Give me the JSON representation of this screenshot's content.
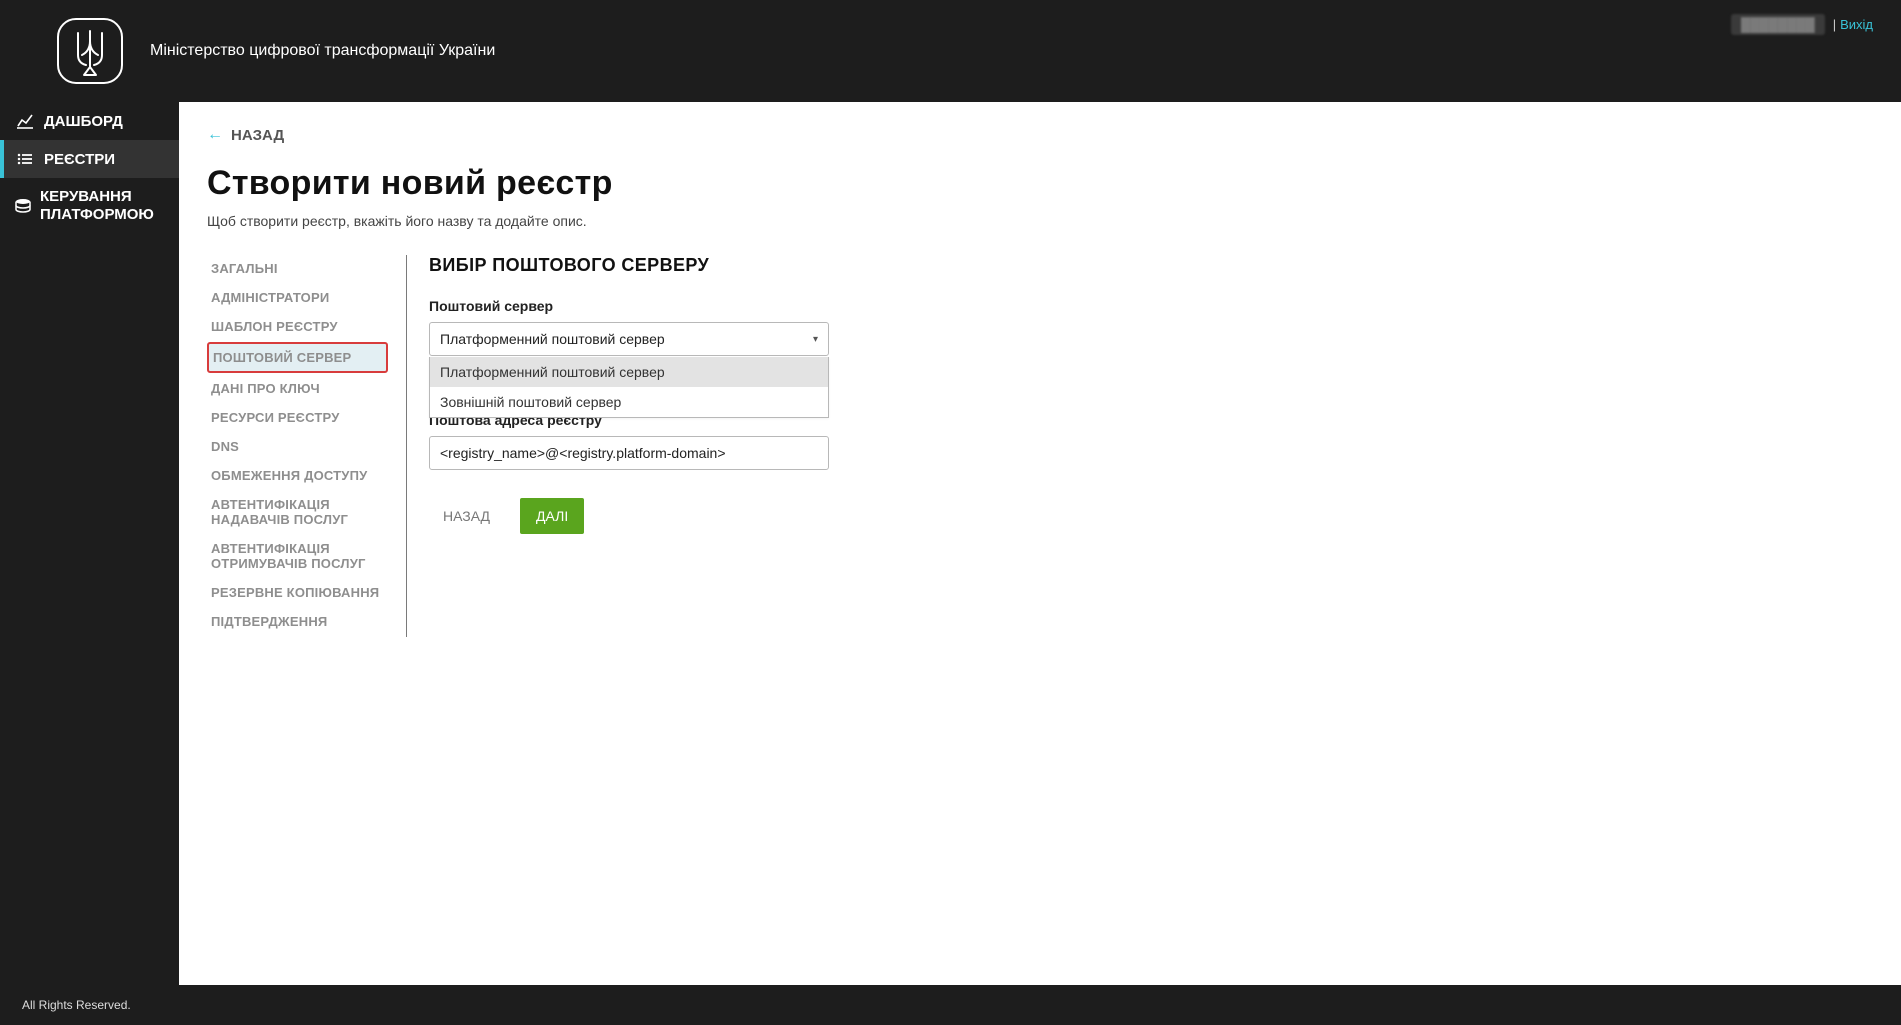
{
  "header": {
    "title": "Міністерство цифрової трансформації України",
    "user_placeholder": "████████",
    "pipe": "|",
    "logout": "Вихід"
  },
  "sidebar": {
    "items": [
      {
        "label": "ДАШБОРД",
        "icon": "chart"
      },
      {
        "label": "РЕЄСТРИ",
        "icon": "list"
      },
      {
        "label": "КЕРУВАННЯ ПЛАТФОРМОЮ",
        "icon": "dbstack"
      }
    ]
  },
  "content": {
    "back_label": "НАЗАД",
    "page_title": "Створити новий реєстр",
    "subtitle": "Щоб створити реєстр, вкажіть його назву та додайте опис."
  },
  "steps": [
    "ЗАГАЛЬНІ",
    "АДМІНІСТРАТОРИ",
    "ШАБЛОН РЕЄСТРУ",
    "ПОШТОВИЙ СЕРВЕР",
    "ДАНІ ПРО КЛЮЧ",
    "РЕСУРСИ РЕЄСТРУ",
    "DNS",
    "ОБМЕЖЕННЯ ДОСТУПУ",
    "АВТЕНТИФІКАЦІЯ НАДАВАЧІВ ПОСЛУГ",
    "АВТЕНТИФІКАЦІЯ ОТРИМУВАЧІВ ПОСЛУГ",
    "РЕЗЕРВНЕ КОПІЮВАННЯ",
    "ПІДТВЕРДЖЕННЯ"
  ],
  "form": {
    "section_title": "ВИБІР ПОШТОВОГО СЕРВЕРУ",
    "server_label": "Поштовий сервер",
    "server_value": "Платформенний поштовий сервер",
    "options": [
      "Платформенний поштовий сервер",
      "Зовнішній поштовий сервер"
    ],
    "addr_label": "Поштова адреса реєстру",
    "addr_value": "<registry_name>@<registry.platform-domain>",
    "btn_back": "НАЗАД",
    "btn_next": "ДАЛІ"
  },
  "footer": {
    "text": "All Rights Reserved."
  }
}
